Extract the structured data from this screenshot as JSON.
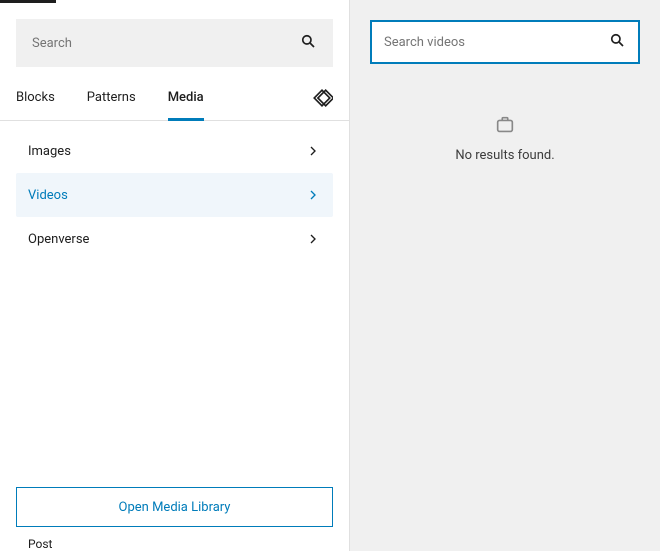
{
  "left": {
    "search_placeholder": "Search",
    "tabs": [
      "Blocks",
      "Patterns",
      "Media"
    ],
    "active_tab": "Media",
    "media_items": [
      {
        "label": "Images",
        "selected": false
      },
      {
        "label": "Videos",
        "selected": true
      },
      {
        "label": "Openverse",
        "selected": false
      }
    ],
    "open_library_label": "Open Media Library",
    "post_label": "Post"
  },
  "right": {
    "search_placeholder": "Search videos",
    "no_results": "No results found."
  }
}
